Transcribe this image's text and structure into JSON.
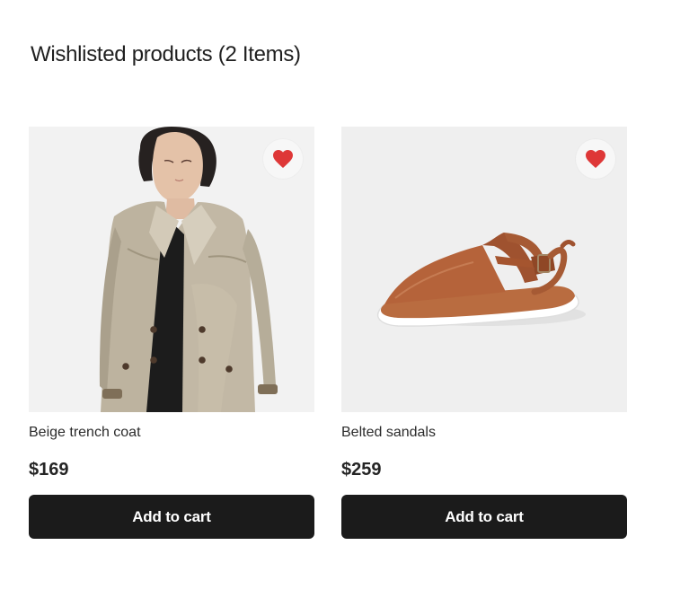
{
  "page": {
    "title": "Wishlisted products (2 Items)"
  },
  "products": [
    {
      "name": "Beige trench coat",
      "price": "$169",
      "button_label": "Add to cart",
      "wish_icon": "heart-icon"
    },
    {
      "name": "Belted sandals",
      "price": "$259",
      "button_label": "Add to cart",
      "wish_icon": "heart-icon"
    }
  ],
  "colors": {
    "heart": "#de3737",
    "button": "#1b1b1b",
    "image_background": "#f1f1f1"
  }
}
